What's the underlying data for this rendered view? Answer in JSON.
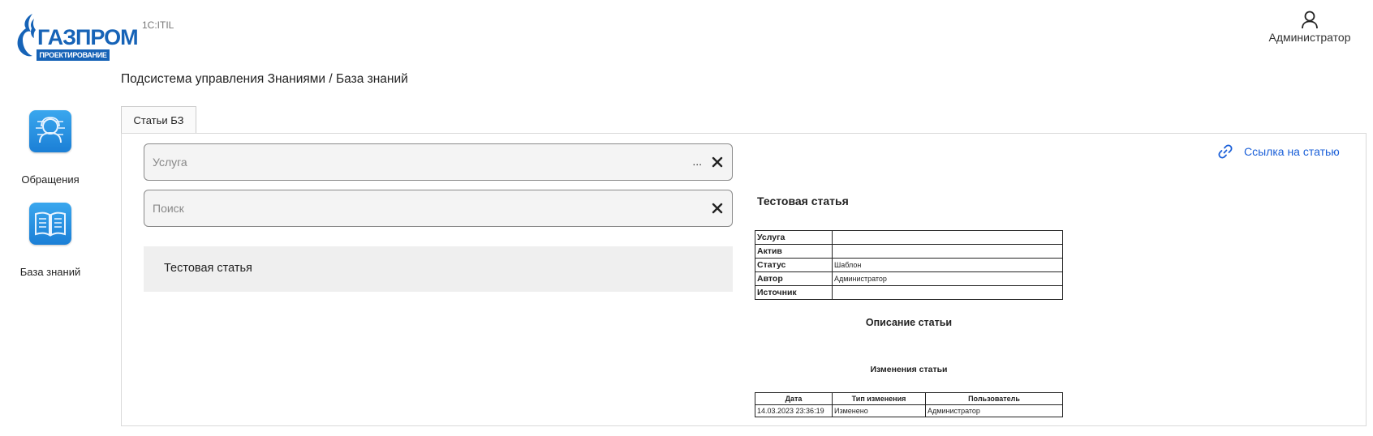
{
  "brand": {
    "name": "ГАЗПРОМ",
    "subtitle": "ПРОЕКТИРОВАНИЕ",
    "color": "#1663b7"
  },
  "header": {
    "app_name": "1C:ITIL",
    "user_name": "Администратор",
    "user_icon": "user-icon"
  },
  "sidebar": {
    "items": [
      {
        "label": "Обращения",
        "icon": "support-agent-icon"
      },
      {
        "label": "База знаний",
        "icon": "book-icon"
      }
    ]
  },
  "breadcrumb": "Подсистема управления Знаниями / База знаний",
  "tabs": [
    {
      "label": "Статьи БЗ",
      "active": true
    }
  ],
  "filters": {
    "service_placeholder": "Услуга",
    "service_dots": "...",
    "search_placeholder": "Поиск"
  },
  "results": [
    {
      "title": "Тестовая статья"
    }
  ],
  "article": {
    "link_label": "Ссылка на статью",
    "title": "Тестовая статья",
    "properties": [
      {
        "key": "Услуга",
        "value": ""
      },
      {
        "key": "Актив",
        "value": ""
      },
      {
        "key": "Статус",
        "value": "Шаблон"
      },
      {
        "key": "Автор",
        "value": "Администратор"
      },
      {
        "key": "Источник",
        "value": ""
      }
    ],
    "description_heading": "Описание статьи",
    "changes_heading": "Изменения статьи",
    "changes_columns": [
      "Дата",
      "Тип изменения",
      "Пользователь"
    ],
    "changes_rows": [
      [
        "14.03.2023 23:36:19",
        "Изменено",
        "Администратор"
      ]
    ]
  },
  "colors": {
    "link": "#1a5fd8",
    "sidebar_icon": "#1b7fd6"
  }
}
